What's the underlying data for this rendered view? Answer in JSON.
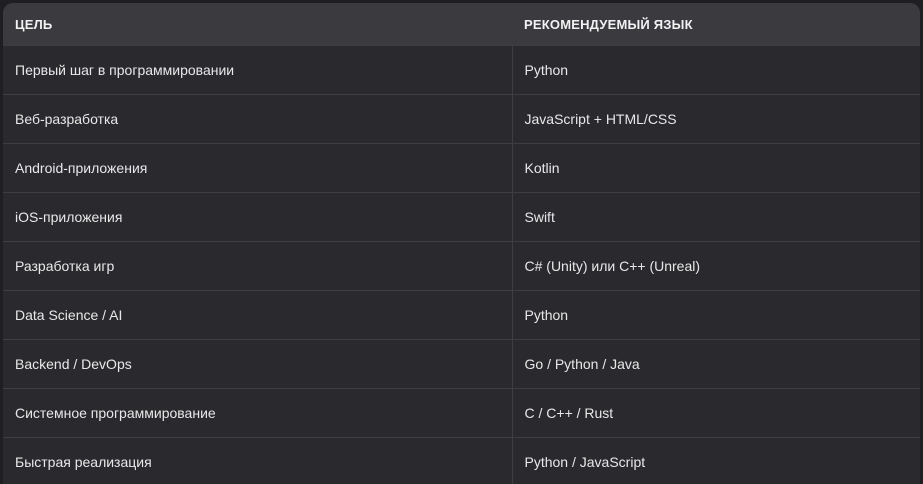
{
  "table": {
    "headers": {
      "goal": "ЦЕЛЬ",
      "language": "РЕКОМЕНДУЕМЫЙ ЯЗЫК"
    },
    "rows": [
      {
        "goal": "Первый шаг в программировании",
        "language": "Python"
      },
      {
        "goal": "Веб-разработка",
        "language": "JavaScript + HTML/CSS"
      },
      {
        "goal": "Android-приложения",
        "language": "Kotlin"
      },
      {
        "goal": "iOS-приложения",
        "language": "Swift"
      },
      {
        "goal": "Разработка игр",
        "language": "C# (Unity) или C++ (Unreal)"
      },
      {
        "goal": "Data Science / AI",
        "language": "Python"
      },
      {
        "goal": "Backend / DevOps",
        "language": "Go / Python / Java"
      },
      {
        "goal": "Системное программирование",
        "language": "C / C++ / Rust"
      },
      {
        "goal": "Быстрая реализация",
        "language": "Python / JavaScript"
      }
    ]
  },
  "colors": {
    "page_background": "#1f1f23",
    "table_background": "#2a2a2e",
    "header_background": "#3a3a3f",
    "divider": "#3d3d42",
    "text": "#e8e8e8"
  }
}
